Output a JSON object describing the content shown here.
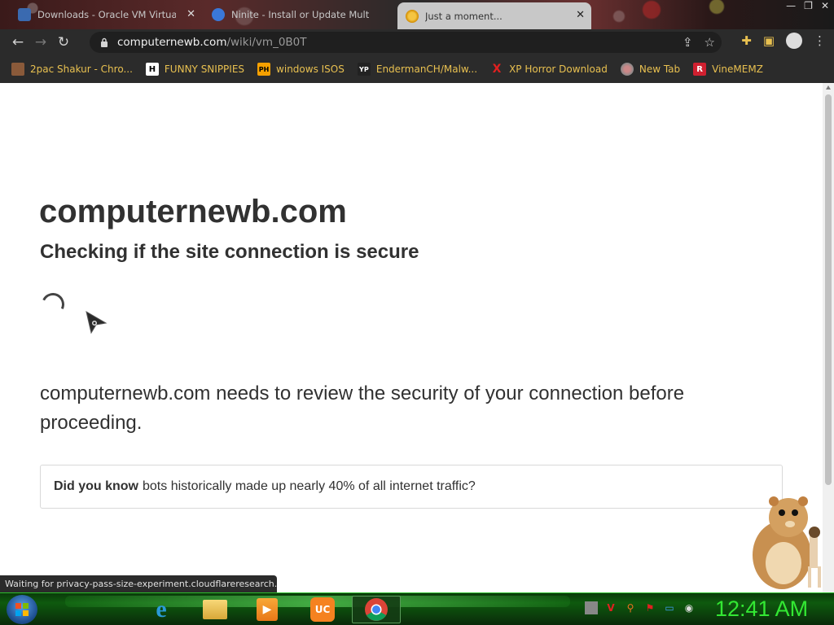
{
  "browser": {
    "tabs": [
      {
        "title": "Downloads - Oracle VM VirtualBox",
        "active": false
      },
      {
        "title": "Ninite - Install or Update Multiple Apps",
        "active": false
      },
      {
        "title": "Just a moment...",
        "active": true
      }
    ],
    "url_host": "computernewb.com",
    "url_path": "/wiki/vm_0B0T",
    "bookmarks": [
      {
        "label": "2pac Shakur - Chro...",
        "icon": "person-icon"
      },
      {
        "label": "FUNNY SNIPPIES",
        "icon": "H"
      },
      {
        "label": "windows ISOS",
        "icon": "PH"
      },
      {
        "label": "EndermanCH/Malw...",
        "icon": "YP"
      },
      {
        "label": "XP Horror Download",
        "icon": "X"
      },
      {
        "label": "New Tab",
        "icon": "globe-icon"
      },
      {
        "label": "VineMEMZ",
        "icon": "R"
      }
    ],
    "status_bubble": "Waiting for privacy-pass-size-experiment.cloudflareresearch...."
  },
  "page": {
    "site_title": "computernewb.com",
    "subtitle": "Checking if the site connection is secure",
    "review_text": "computernewb.com needs to review the security of your connection before proceeding.",
    "did_you_know_bold": "Did you know",
    "did_you_know_text": "bots historically made up nearly 40% of all internet traffic?"
  },
  "taskbar": {
    "clock": "12:41 AM",
    "apps": [
      "internet-explorer",
      "file-explorer",
      "media-player",
      "uc-browser",
      "chrome"
    ],
    "accent_color": "#33e833"
  },
  "colors": {
    "page_text": "#313131",
    "bookmark_text": "#e8c050",
    "chrome_dark": "#2b2b2b"
  }
}
